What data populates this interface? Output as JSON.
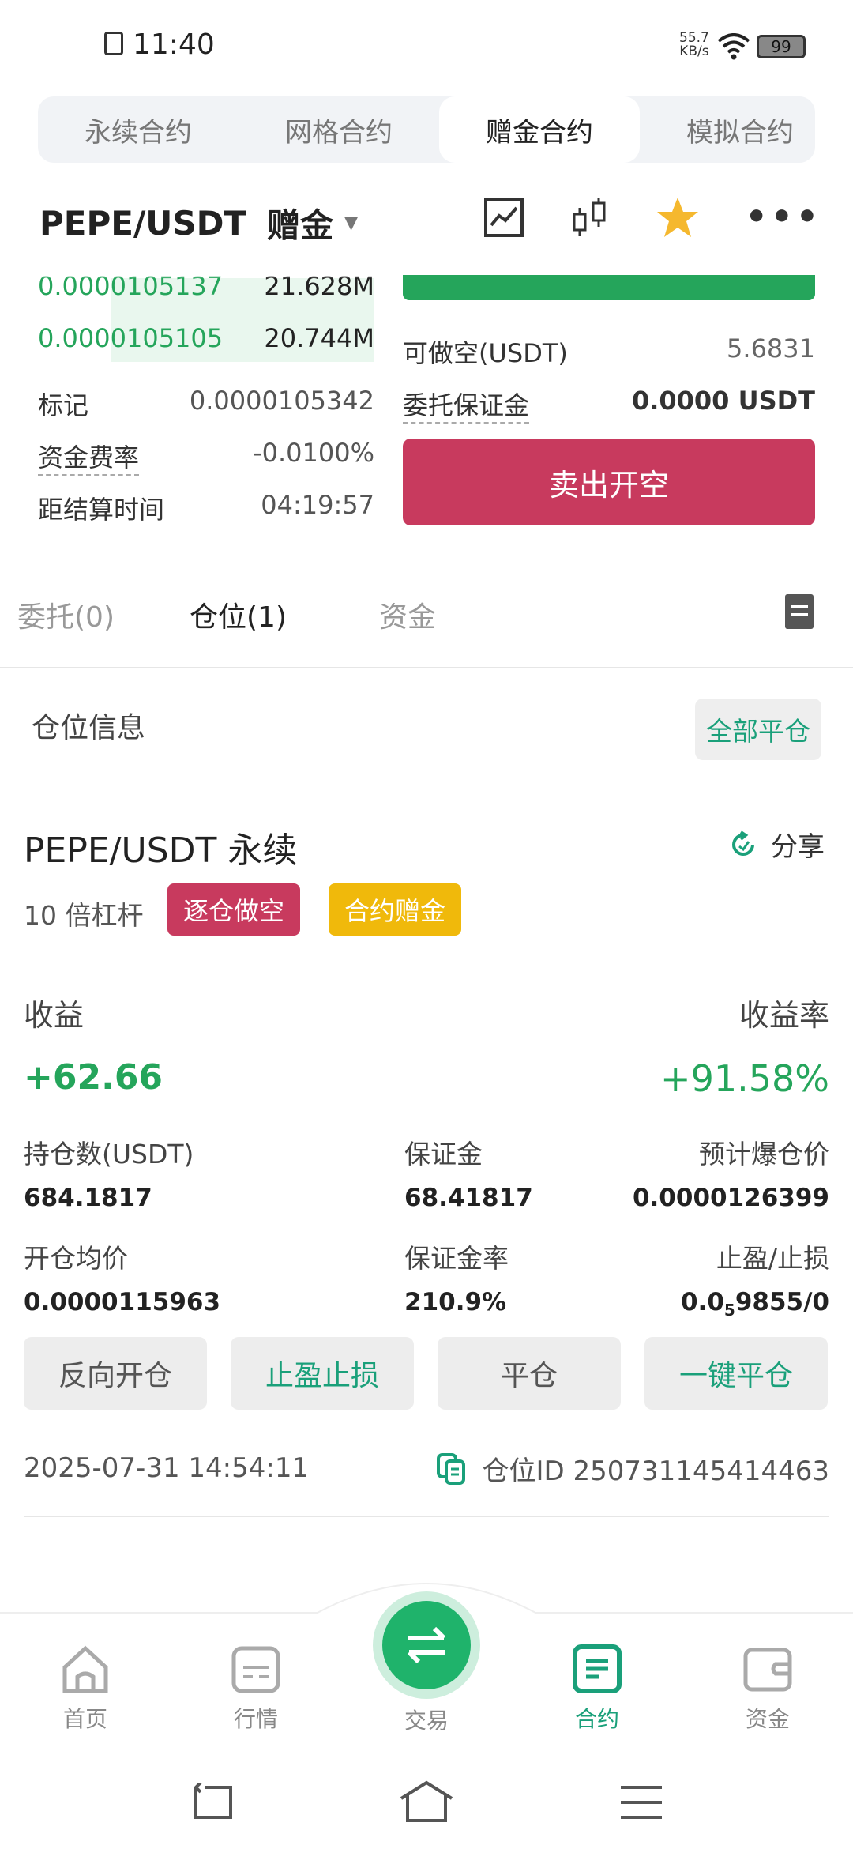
{
  "status_bar": {
    "time": "11:40",
    "speed": "55.7",
    "speed_unit": "KB/s",
    "battery": "99"
  },
  "top_tabs": [
    "永续合约",
    "网格合约",
    "赠金合约",
    "模拟合约"
  ],
  "pair": {
    "symbol": "PEPE/USDT",
    "mode": "赠金"
  },
  "order_book": [
    {
      "price": "0.0000105137",
      "amount": "21.628M"
    },
    {
      "price": "0.0000105105",
      "amount": "20.744M"
    }
  ],
  "stats": {
    "mark_label": "标记",
    "mark_value": "0.0000105342",
    "funding_label": "资金费率",
    "funding_value": "-0.0100%",
    "settle_label": "距结算时间",
    "settle_value": "04:19:57"
  },
  "right_panel": {
    "short_label": "可做空(USDT)",
    "short_value": "5.6831",
    "margin_label": "委托保证金",
    "margin_value": "0.0000 USDT",
    "sell_button": "卖出开空"
  },
  "position_tabs": {
    "orders": "委托(0)",
    "positions": "仓位(1)",
    "funds": "资金"
  },
  "position_info": {
    "title": "仓位信息",
    "close_all": "全部平仓"
  },
  "position": {
    "name": "PEPE/USDT 永续",
    "share": "分享",
    "leverage": "10 倍杠杆",
    "tag_short": "逐仓做空",
    "tag_bonus": "合约赠金",
    "pnl_label": "收益",
    "pnl_value": "+62.66",
    "roe_label": "收益率",
    "roe_value": "+91.58%",
    "size_label": "持仓数(USDT)",
    "size_value": "684.1817",
    "margin_label": "保证金",
    "margin_value": "68.41817",
    "liq_label": "预计爆仓价",
    "liq_value": "0.0000126399",
    "entry_label": "开仓均价",
    "entry_value": "0.0000115963",
    "margin_ratio_label": "保证金率",
    "margin_ratio_value": "210.9%",
    "tpsl_label": "止盈/止损",
    "tpsl_value_prefix": "0.0",
    "tpsl_value_sub": "5",
    "tpsl_value_suffix": "9855/0",
    "time": "2025-07-31 14:54:11",
    "id_label": "仓位ID 250731145414463"
  },
  "action_buttons": [
    "反向开仓",
    "止盈止损",
    "平仓",
    "一键平仓"
  ],
  "bottom_nav": [
    "首页",
    "行情",
    "交易",
    "合约",
    "资金"
  ],
  "colors": {
    "green": "#25a55b",
    "teal": "#1aa07a",
    "red": "#c83a5e",
    "yellow": "#f0b90b"
  }
}
